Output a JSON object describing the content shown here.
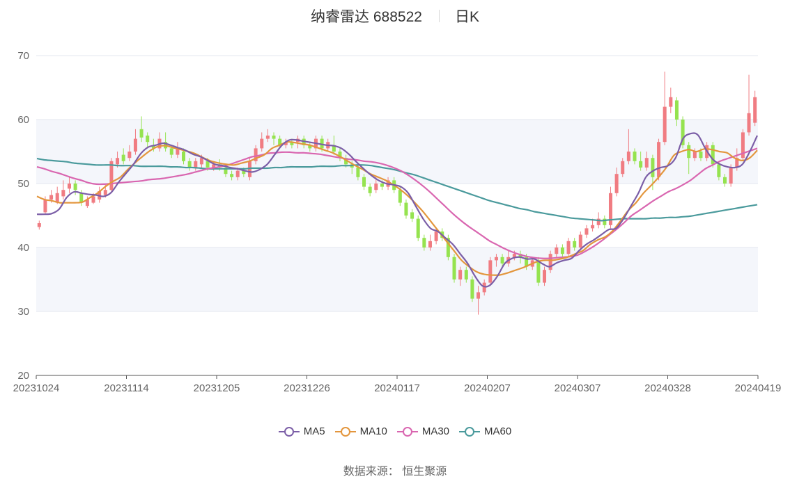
{
  "header": {
    "title": "纳睿雷达 688522",
    "period": "日K"
  },
  "source": {
    "label": "数据来源：",
    "value": "恒生聚源"
  },
  "colors": {
    "up": "#f07c82",
    "down": "#95e34f",
    "ma5": "#7b5ea7",
    "ma10": "#e3963d",
    "ma30": "#d966b0",
    "ma60": "#4a9a9c",
    "grid": "#e3e7ef",
    "band": "#f4f6fb",
    "axis": "#666666"
  },
  "chart_data": {
    "type": "candlestick",
    "ylim": [
      20,
      70
    ],
    "yticks": [
      20,
      30,
      40,
      50,
      60,
      70
    ],
    "xticks": [
      "20231024",
      "20231114",
      "20231205",
      "20231226",
      "20240117",
      "20240207",
      "20240307",
      "20240328",
      "20240419"
    ],
    "legend": [
      "MA5",
      "MA10",
      "MA30",
      "MA60"
    ],
    "legend_position": "bottom",
    "candles": [
      [
        43.2,
        43.8,
        44.2,
        42.8
      ],
      [
        45.5,
        47.5,
        48.0,
        45.2
      ],
      [
        47.5,
        48.2,
        49.0,
        47.0
      ],
      [
        47.0,
        48.5,
        49.5,
        46.8
      ],
      [
        48.0,
        49.0,
        50.5,
        47.5
      ],
      [
        49.2,
        50.0,
        51.0,
        48.5
      ],
      [
        50.0,
        49.0,
        50.5,
        48.2
      ],
      [
        48.5,
        47.0,
        49.0,
        46.5
      ],
      [
        46.5,
        47.5,
        48.0,
        46.2
      ],
      [
        47.0,
        48.0,
        48.5,
        46.8
      ],
      [
        47.5,
        48.8,
        49.5,
        47.0
      ],
      [
        48.2,
        49.0,
        49.8,
        47.8
      ],
      [
        49.0,
        53.5,
        54.0,
        48.5
      ],
      [
        53.0,
        54.0,
        55.0,
        52.5
      ],
      [
        54.5,
        53.5,
        55.5,
        53.0
      ],
      [
        54.0,
        55.0,
        56.0,
        53.5
      ],
      [
        55.0,
        57.0,
        58.5,
        54.5
      ],
      [
        58.5,
        57.2,
        60.5,
        56.5
      ],
      [
        57.5,
        56.5,
        58.0,
        55.5
      ],
      [
        56.0,
        55.5,
        57.0,
        55.0
      ],
      [
        55.5,
        57.0,
        58.0,
        55.0
      ],
      [
        56.5,
        55.5,
        58.0,
        55.0
      ],
      [
        55.5,
        54.5,
        56.0,
        54.0
      ],
      [
        54.5,
        55.5,
        56.5,
        54.0
      ],
      [
        55.0,
        53.5,
        55.5,
        53.0
      ],
      [
        53.5,
        52.5,
        54.0,
        52.0
      ],
      [
        52.5,
        53.5,
        54.0,
        52.0
      ],
      [
        53.0,
        54.0,
        54.5,
        52.5
      ],
      [
        53.5,
        52.5,
        54.0,
        52.0
      ],
      [
        52.5,
        53.0,
        53.5,
        52.0
      ],
      [
        53.0,
        52.5,
        53.8,
        52.0
      ],
      [
        52.5,
        51.5,
        53.0,
        51.0
      ],
      [
        51.5,
        51.0,
        52.0,
        50.5
      ],
      [
        51.0,
        52.0,
        52.5,
        50.5
      ],
      [
        52.0,
        51.5,
        52.5,
        51.0
      ],
      [
        51.0,
        53.5,
        54.0,
        50.5
      ],
      [
        53.5,
        55.5,
        56.0,
        53.0
      ],
      [
        55.5,
        57.0,
        58.0,
        55.0
      ],
      [
        57.0,
        57.5,
        58.5,
        56.5
      ],
      [
        57.5,
        57.0,
        58.0,
        56.0
      ],
      [
        57.0,
        56.0,
        57.5,
        55.5
      ],
      [
        56.0,
        56.5,
        57.0,
        55.5
      ],
      [
        56.5,
        56.0,
        57.0,
        55.5
      ],
      [
        56.5,
        57.0,
        57.5,
        55.5
      ],
      [
        57.0,
        56.0,
        57.5,
        55.5
      ],
      [
        56.0,
        55.5,
        56.5,
        55.0
      ],
      [
        55.5,
        57.0,
        57.5,
        55.0
      ],
      [
        57.0,
        55.5,
        57.5,
        55.0
      ],
      [
        55.5,
        56.5,
        57.0,
        55.0
      ],
      [
        56.0,
        55.0,
        57.5,
        54.5
      ],
      [
        55.0,
        54.0,
        55.5,
        53.5
      ],
      [
        54.0,
        53.0,
        54.5,
        52.5
      ],
      [
        53.0,
        52.5,
        53.5,
        51.5
      ],
      [
        52.5,
        51.0,
        53.0,
        50.5
      ],
      [
        51.0,
        49.5,
        51.5,
        49.0
      ],
      [
        49.5,
        48.5,
        50.0,
        48.0
      ],
      [
        49.0,
        50.0,
        51.0,
        48.5
      ],
      [
        50.0,
        49.5,
        50.5,
        49.0
      ],
      [
        49.5,
        50.5,
        51.0,
        49.0
      ],
      [
        50.5,
        49.0,
        51.0,
        48.5
      ],
      [
        49.0,
        47.0,
        49.5,
        46.5
      ],
      [
        47.0,
        45.0,
        47.5,
        44.5
      ],
      [
        45.5,
        44.5,
        46.0,
        44.0
      ],
      [
        44.5,
        41.5,
        45.0,
        41.0
      ],
      [
        41.5,
        40.0,
        42.0,
        39.5
      ],
      [
        40.0,
        41.0,
        42.0,
        39.5
      ],
      [
        41.0,
        42.5,
        43.0,
        40.5
      ],
      [
        42.5,
        41.5,
        43.0,
        41.0
      ],
      [
        41.5,
        38.5,
        42.0,
        38.0
      ],
      [
        38.5,
        35.0,
        39.0,
        34.5
      ],
      [
        35.0,
        36.5,
        37.0,
        34.0
      ],
      [
        36.5,
        35.0,
        37.0,
        34.5
      ],
      [
        35.0,
        32.0,
        35.5,
        31.5
      ],
      [
        32.0,
        33.0,
        34.0,
        29.5
      ],
      [
        33.0,
        34.5,
        35.0,
        32.5
      ],
      [
        34.5,
        38.0,
        38.5,
        34.0
      ],
      [
        38.0,
        38.5,
        39.0,
        37.0
      ],
      [
        38.5,
        37.5,
        39.0,
        37.0
      ],
      [
        37.5,
        38.5,
        39.5,
        37.0
      ],
      [
        38.5,
        39.0,
        39.5,
        38.0
      ],
      [
        39.0,
        38.5,
        39.5,
        37.5
      ],
      [
        38.5,
        37.0,
        39.0,
        36.5
      ],
      [
        37.0,
        38.0,
        38.5,
        36.5
      ],
      [
        38.0,
        34.5,
        38.5,
        34.0
      ],
      [
        34.5,
        36.5,
        37.0,
        34.0
      ],
      [
        36.5,
        39.0,
        39.5,
        36.0
      ],
      [
        39.0,
        40.0,
        40.5,
        38.5
      ],
      [
        40.0,
        39.0,
        40.5,
        38.5
      ],
      [
        39.0,
        41.0,
        41.5,
        38.5
      ],
      [
        41.0,
        40.0,
        41.5,
        39.5
      ],
      [
        40.0,
        42.0,
        42.5,
        39.5
      ],
      [
        42.0,
        43.0,
        43.5,
        41.5
      ],
      [
        43.0,
        43.5,
        44.5,
        42.5
      ],
      [
        43.5,
        44.5,
        45.5,
        43.0
      ],
      [
        44.5,
        43.5,
        45.0,
        43.0
      ],
      [
        43.5,
        48.5,
        49.5,
        43.0
      ],
      [
        48.5,
        51.5,
        52.5,
        48.0
      ],
      [
        51.5,
        53.5,
        54.0,
        51.0
      ],
      [
        53.5,
        55.0,
        58.5,
        53.0
      ],
      [
        55.0,
        53.5,
        55.5,
        53.0
      ],
      [
        53.5,
        52.5,
        55.0,
        52.0
      ],
      [
        52.5,
        54.0,
        55.0,
        52.0
      ],
      [
        54.0,
        51.0,
        54.5,
        49.0
      ],
      [
        51.0,
        56.5,
        57.0,
        50.5
      ],
      [
        56.5,
        62.0,
        67.5,
        56.0
      ],
      [
        62.0,
        63.5,
        65.0,
        61.0
      ],
      [
        63.0,
        60.0,
        63.5,
        59.0
      ],
      [
        60.0,
        56.0,
        60.5,
        55.5
      ],
      [
        56.0,
        54.0,
        56.5,
        51.5
      ],
      [
        54.0,
        55.0,
        55.5,
        53.5
      ],
      [
        55.0,
        54.0,
        55.5,
        53.5
      ],
      [
        54.0,
        56.0,
        56.5,
        53.5
      ],
      [
        56.0,
        53.0,
        56.5,
        52.5
      ],
      [
        53.0,
        51.0,
        53.5,
        50.5
      ],
      [
        51.0,
        50.0,
        51.5,
        49.5
      ],
      [
        50.0,
        52.5,
        53.0,
        49.5
      ],
      [
        52.5,
        54.0,
        55.5,
        52.0
      ],
      [
        54.0,
        58.0,
        58.5,
        53.5
      ],
      [
        58.0,
        61.0,
        67.0,
        57.5
      ],
      [
        59.5,
        63.5,
        64.5,
        59.0
      ]
    ],
    "series": [
      {
        "name": "MA5",
        "values": [
          45.2,
          45.2,
          45.3,
          46.0,
          47.8,
          48.7,
          48.5,
          48.3,
          48.2,
          48.0,
          48.6,
          50.2,
          51.6,
          53.0,
          54.7,
          55.7,
          56.0,
          56.3,
          56.0,
          55.6,
          55.2,
          54.6,
          54.2,
          53.6,
          53.0,
          52.8,
          52.5,
          52.3,
          52.0,
          51.8,
          52.2,
          53.0,
          54.5,
          56.0,
          56.8,
          56.8,
          56.6,
          56.4,
          56.2,
          56.0,
          55.9,
          55.5,
          54.6,
          53.4,
          52.3,
          51.3,
          50.5,
          50.0,
          49.8,
          49.5,
          48.5,
          46.5,
          44.5,
          43.0,
          42.5,
          41.5,
          40.5,
          39.0,
          37.5,
          35.5,
          34.0,
          34.1,
          35.5,
          37.5,
          38.3,
          38.5,
          38.2,
          38.2,
          37.5,
          37.0,
          37.6,
          38.0,
          38.3,
          39.5,
          40.5,
          41.2,
          42.0,
          42.8,
          43.0,
          44.5,
          46.5,
          48.5,
          51.0,
          52.0,
          52.5,
          52.8,
          54.0,
          57.0,
          57.8,
          57.6,
          55.5,
          53.8,
          53.0,
          52.6,
          52.5,
          53.0,
          55.0,
          57.5
        ]
      },
      {
        "name": "MA10",
        "values": [
          48.0,
          47.5,
          47.3,
          47.0,
          47.0,
          47.0,
          47.1,
          47.8,
          48.5,
          49.5,
          50.3,
          51.0,
          52.2,
          53.3,
          54.3,
          55.2,
          55.8,
          55.9,
          55.6,
          55.3,
          55.0,
          54.6,
          54.0,
          53.5,
          53.2,
          53.0,
          52.9,
          53.2,
          53.5,
          54.0,
          54.5,
          55.5,
          56.0,
          56.5,
          56.4,
          56.2,
          56.0,
          55.6,
          55.2,
          54.8,
          54.2,
          53.5,
          52.8,
          52.2,
          51.5,
          51.0,
          50.5,
          49.8,
          49.0,
          48.0,
          46.8,
          45.5,
          44.0,
          42.5,
          41.0,
          39.5,
          38.0,
          37.0,
          36.2,
          35.8,
          35.7,
          35.7,
          36.0,
          36.4,
          36.8,
          37.3,
          37.8,
          38.0,
          38.0,
          38.2,
          38.5,
          39.0,
          39.5,
          40.5,
          41.2,
          41.7,
          42.7,
          44.2,
          45.8,
          47.0,
          48.5,
          49.7,
          51.0,
          52.5,
          54.4,
          55.0,
          55.3,
          55.0,
          55.4,
          55.3,
          55.0,
          54.8,
          54.0,
          53.6,
          54.0,
          55.2
        ]
      },
      {
        "name": "MA30",
        "values": [
          52.6,
          52.3,
          51.9,
          51.6,
          51.2,
          50.8,
          50.5,
          50.1,
          49.9,
          49.9,
          50.0,
          50.1,
          50.2,
          50.3,
          50.4,
          50.6,
          50.7,
          50.8,
          51.0,
          51.2,
          51.4,
          51.7,
          52.0,
          52.3,
          52.5,
          52.7,
          53.0,
          53.4,
          53.8,
          54.2,
          54.4,
          54.7,
          54.8,
          54.9,
          54.9,
          54.8,
          54.8,
          54.7,
          54.6,
          54.4,
          54.2,
          54.0,
          53.8,
          53.7,
          53.5,
          53.4,
          53.2,
          52.9,
          52.5,
          52.0,
          51.3,
          50.5,
          49.6,
          48.6,
          47.5,
          46.4,
          45.3,
          44.3,
          43.4,
          42.6,
          41.8,
          41.0,
          40.4,
          39.8,
          39.3,
          38.9,
          38.6,
          38.4,
          38.3,
          38.3,
          38.4,
          38.5,
          38.6,
          38.9,
          39.5,
          40.2,
          41.0,
          41.9,
          42.8,
          43.8,
          44.9,
          45.7,
          46.5,
          47.3,
          48.0,
          48.7,
          49.2,
          49.8,
          50.5,
          51.4,
          52.3,
          52.9,
          53.5,
          53.9,
          54.3,
          54.7,
          55.1,
          55.5
        ]
      },
      {
        "name": "MA60",
        "values": [
          53.9,
          53.7,
          53.6,
          53.5,
          53.4,
          53.2,
          53.1,
          53.0,
          52.9,
          52.9,
          52.9,
          52.8,
          52.8,
          52.8,
          52.7,
          52.7,
          52.7,
          52.7,
          52.6,
          52.6,
          52.5,
          52.5,
          52.4,
          52.3,
          52.3,
          52.3,
          52.3,
          52.3,
          52.3,
          52.4,
          52.4,
          52.4,
          52.5,
          52.5,
          52.6,
          52.6,
          52.6,
          52.6,
          52.7,
          52.7,
          52.7,
          52.8,
          52.8,
          52.9,
          52.9,
          52.8,
          52.6,
          52.4,
          52.2,
          51.9,
          51.6,
          51.3,
          50.9,
          50.5,
          50.1,
          49.7,
          49.3,
          48.9,
          48.5,
          48.1,
          47.7,
          47.3,
          47.0,
          46.7,
          46.4,
          46.1,
          45.9,
          45.6,
          45.4,
          45.2,
          45.0,
          44.8,
          44.6,
          44.5,
          44.4,
          44.3,
          44.2,
          44.3,
          44.4,
          44.5,
          44.5,
          44.5,
          44.5,
          44.6,
          44.6,
          44.7,
          44.7,
          44.8,
          44.9,
          45.1,
          45.3,
          45.5,
          45.7,
          45.9,
          46.1,
          46.3,
          46.5,
          46.7
        ]
      }
    ]
  }
}
